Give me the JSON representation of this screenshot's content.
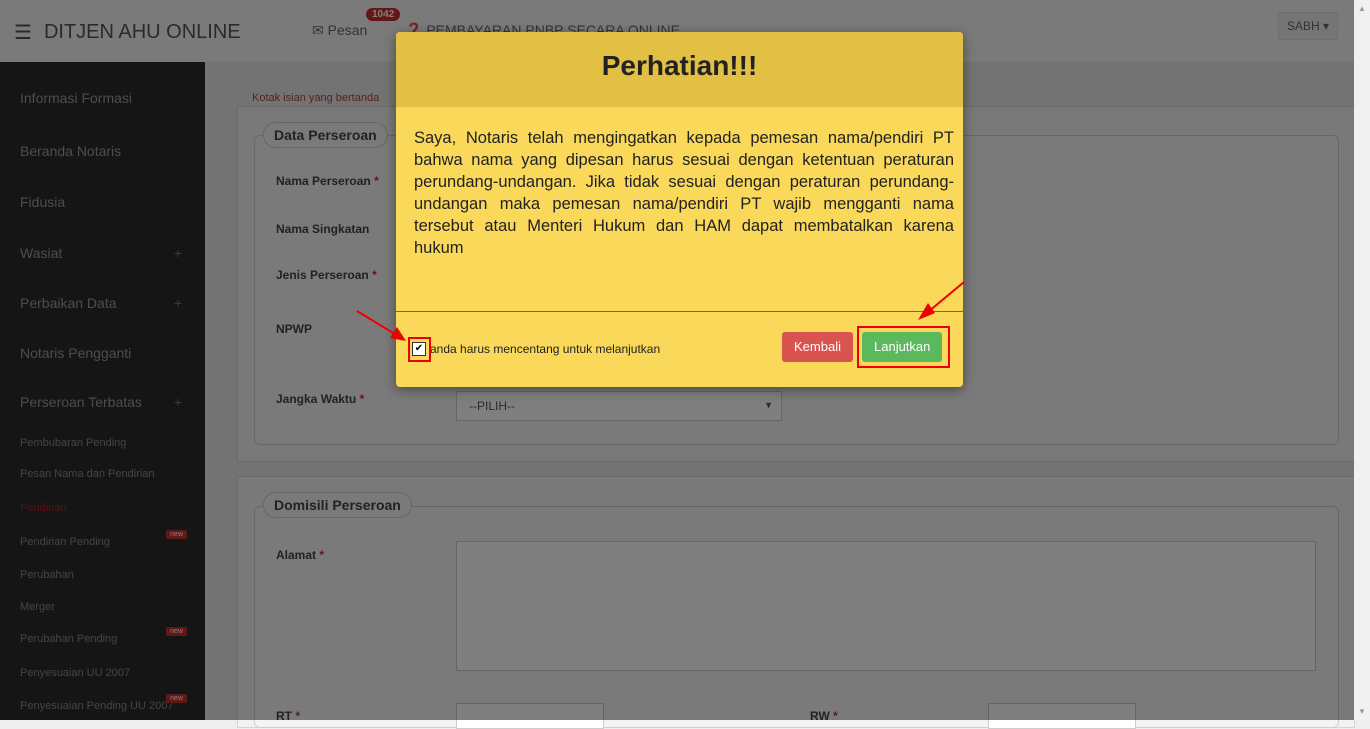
{
  "navbar": {
    "brand": "DITJEN AHU ONLINE",
    "messages_label": "Pesan",
    "messages_count": "1042",
    "pnbp_label": "PEMBAYARAN PNBP SECARA ONLINE",
    "user": "SABH"
  },
  "sidebar": {
    "items": [
      {
        "label": "Informasi Formasi"
      },
      {
        "label": "Beranda Notaris"
      },
      {
        "label": "Fidusia"
      },
      {
        "label": "Wasiat",
        "expand": "+"
      },
      {
        "label": "Perbaikan Data",
        "expand": "+"
      },
      {
        "label": "Notaris Pengganti"
      },
      {
        "label": "Perseroan Terbatas",
        "expand": "+"
      }
    ],
    "subitems": [
      {
        "label": "Pembubaran Pending"
      },
      {
        "label": "Pesan Nama dan Pendirian"
      },
      {
        "label": "Pendirian"
      },
      {
        "label": "Pendirian Pending",
        "badge": "new"
      },
      {
        "label": "Perubahan"
      },
      {
        "label": "Merger"
      },
      {
        "label": "Perubahan Pending",
        "badge": "new"
      },
      {
        "label": "Penyesuaian UU 2007"
      },
      {
        "label": "Penyesuaian Pending UU 2007",
        "badge": "new"
      }
    ]
  },
  "form": {
    "required_note": "Kotak isian yang bertanda",
    "section1": "Data Perseroan",
    "labels": {
      "nama_perseroan": "Nama Perseroan",
      "nama_singkatan": "Nama Singkatan",
      "jenis_perseroan": "Jenis Perseroan",
      "npwp": "NPWP",
      "jangka_waktu": "Jangka Waktu"
    },
    "required_mark": "*",
    "jangka_select": "--PILIH--",
    "section2": "Domisili Perseroan",
    "alamat": "Alamat",
    "rt": "RT",
    "rw": "RW"
  },
  "modal": {
    "title": "Perhatian!!!",
    "body": "Saya, Notaris telah mengingatkan kepada pemesan nama/pendiri PT bahwa nama yang dipesan harus sesuai dengan ketentuan peraturan perundang-undangan. Jika tidak sesuai dengan peraturan perundang-undangan maka pemesan nama/pendiri PT wajib mengganti nama tersebut atau Menteri Hukum dan HAM dapat membatalkan karena hukum",
    "checkbox_label": "anda harus mencentang untuk melanjutkan",
    "checkbox_checked": true,
    "back_button": "Kembali",
    "continue_button": "Lanjutkan"
  },
  "colors": {
    "modal_bg": "#f9d85a",
    "modal_header": "#e2c043",
    "danger": "#d9534f",
    "success": "#5cb85c",
    "annotation": "#ee0000"
  }
}
